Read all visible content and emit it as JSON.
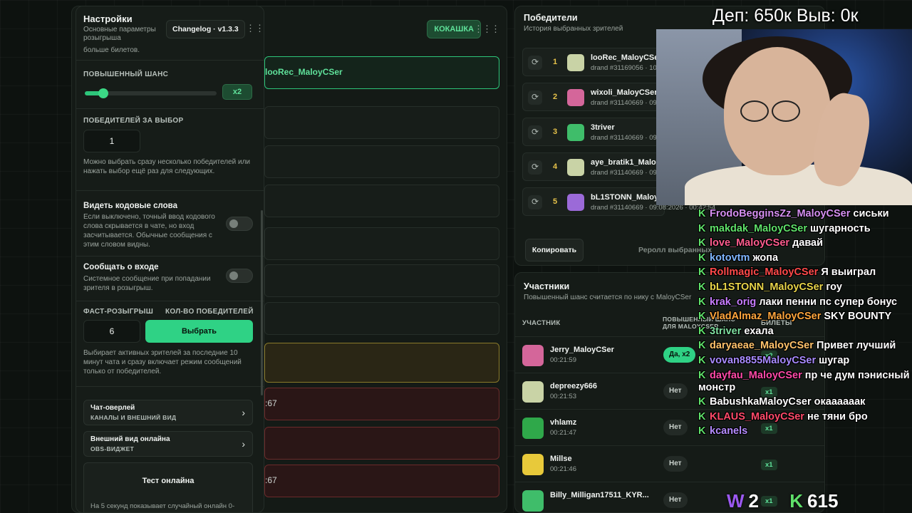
{
  "middle": {
    "badge": "КОКАШКА",
    "rows": [
      "looRec_MaloyCSer",
      "",
      ":67",
      ":67"
    ]
  },
  "settings": {
    "title": "Настройки",
    "subtitle": "Основные параметры розыгрыша",
    "changelog": "Changelog · v1.3.3",
    "top_text": "больше билетов.",
    "boost_label": "ПОВЫШЕННЫЙ ШАНС",
    "boost_value": "x2",
    "boost_level": 0.14,
    "per_pick_label": "ПОБЕДИТЕЛЕЙ ЗА ВЫБОР",
    "per_pick_value": "1",
    "per_pick_help": "Можно выбрать сразу несколько победителей или нажать выбор ещё раз для следующих.",
    "code_words_title": "Видеть кодовые слова",
    "code_words_help": "Если выключено, точный ввод кодового слова скрывается в чате, но вход засчитывается. Обычные сообщения с этим словом видны.",
    "report_entry_title": "Сообщать о входе",
    "report_entry_help": "Системное сообщение при попадании зрителя в розыгрыш.",
    "fast_label": "ФАСТ-РОЗЫГРЫШ",
    "count_label": "КОЛ-ВО ПОБЕДИТЕЛЕЙ",
    "fast_value": "6",
    "choose_button": "Выбрать",
    "fast_help": "Выбирает активных зрителей за последние 10 минут чата и сразу включает режим сообщений только от победителей.",
    "nav1_title": "Чат-оверлей",
    "nav1_sub": "КАНАЛЫ И ВНЕШНИЙ ВИД",
    "nav2_title": "Внешний вид онлайна",
    "nav2_sub": "OBS-ВИДЖЕТ",
    "test_title": "Тест онлайна",
    "test_help": "На 5 секунд показывает случайный онлайн 0-"
  },
  "winners": {
    "title": "Победители",
    "subtitle": "История выбранных зрителей",
    "items": [
      {
        "rank": "1",
        "name": "looRec_MaloyCSer",
        "draw": "drand #31169056 · 10:",
        "color": "#c9d3a6"
      },
      {
        "rank": "2",
        "name": "wixoli_MaloyCSer",
        "draw": "drand #31140669 · 09:",
        "color": "#d4669a"
      },
      {
        "rank": "3",
        "name": "3triver",
        "draw": "drand #31140669 · 09:",
        "color": "#3fbd6a"
      },
      {
        "rank": "4",
        "name": "aye_bratik1_Maloy",
        "draw": "drand #31140669 · 09:",
        "color": "#c9d3a6"
      },
      {
        "rank": "5",
        "name": "bL1STONN_Maloy",
        "draw": "drand #31140669 · 09:08:2026 · 00:42:54",
        "color": "#9b6ad8"
      }
    ],
    "copy_button": "Копировать",
    "reroll_button": "Реролл выбранных"
  },
  "participants": {
    "title": "Участники",
    "subtitle": "Повышенный шанс считается по нику с MaloyCSer",
    "col_participant": "УЧАСТНИК",
    "col_boost": "ПОВЫШЕННЫЙ ШАНС ДЛЯ MALOYCSER",
    "col_tickets": "БИЛЕТЫ",
    "rows": [
      {
        "name": "Jerry_MaloyCSer",
        "time": "00:21:59",
        "badge": "Да, x2",
        "yes": true,
        "tickets": "x2",
        "color": "#d4669a"
      },
      {
        "name": "depreezy666",
        "time": "00:21:53",
        "badge": "Нет",
        "yes": false,
        "tickets": "x1",
        "color": "#c9d3a6"
      },
      {
        "name": "vhlamz",
        "time": "00:21:47",
        "badge": "Нет",
        "yes": false,
        "tickets": "x1",
        "color": "#2fa84a"
      },
      {
        "name": "Millse",
        "time": "00:21:46",
        "badge": "Нет",
        "yes": false,
        "tickets": "x1",
        "color": "#e8c93a"
      },
      {
        "name": "Billy_Milligan17511_KYR...",
        "time": "",
        "badge": "Нет",
        "yes": false,
        "tickets": "x1",
        "color": "#3fbd6a"
      }
    ]
  },
  "overlay": {
    "top": "Деп: 650к Выв: 0к",
    "viewers_w": "2",
    "viewers_k": "615"
  },
  "chat": [
    {
      "user": "FrodoBegginsZz_MaloyCSer",
      "text": "сиськи",
      "color": "#d48ff0"
    },
    {
      "user": "makdak_MaloyCSer",
      "text": "шугарность",
      "color": "#5fe16a"
    },
    {
      "user": "love_MaloyCSer",
      "text": "давай",
      "color": "#ff5d8f"
    },
    {
      "user": "kotovtm",
      "text": "жопа",
      "color": "#7fb6ff"
    },
    {
      "user": "Rollmagic_MaloyCSer",
      "text": "Я выиграл",
      "color": "#ff4a4a"
    },
    {
      "user": "bL1STONN_MaloyCSer",
      "text": "гоу",
      "color": "#e8d54a"
    },
    {
      "user": "krak_orig",
      "text": "лаки пенни пс супер бонус",
      "color": "#c77dff"
    },
    {
      "user": "VladAlmaz_MaloyCSer",
      "text": "SKY BOUNTY",
      "color": "#ffa63d"
    },
    {
      "user": "3triver",
      "text": "ехала",
      "color": "#7fe0a0"
    },
    {
      "user": "daryaeae_MaloyCSer",
      "text": "Привет лучший",
      "color": "#ffc26b"
    },
    {
      "user": "vovan8855MaloyCSer",
      "text": "шугар",
      "color": "#a88bff"
    },
    {
      "user": "dayfau_MaloyCSer",
      "text": "пр че дум пэнисный монстр",
      "color": "#ff4aa8"
    },
    {
      "user": "BabushkaMaloyCser",
      "text": "окаааааак",
      "color": "#ffffff"
    },
    {
      "user": "KLAUS_MaloyCSer",
      "text": "не тяни бро",
      "color": "#ff4a6a"
    },
    {
      "user": "kcanels",
      "text": "",
      "color": "#b58cff"
    }
  ]
}
